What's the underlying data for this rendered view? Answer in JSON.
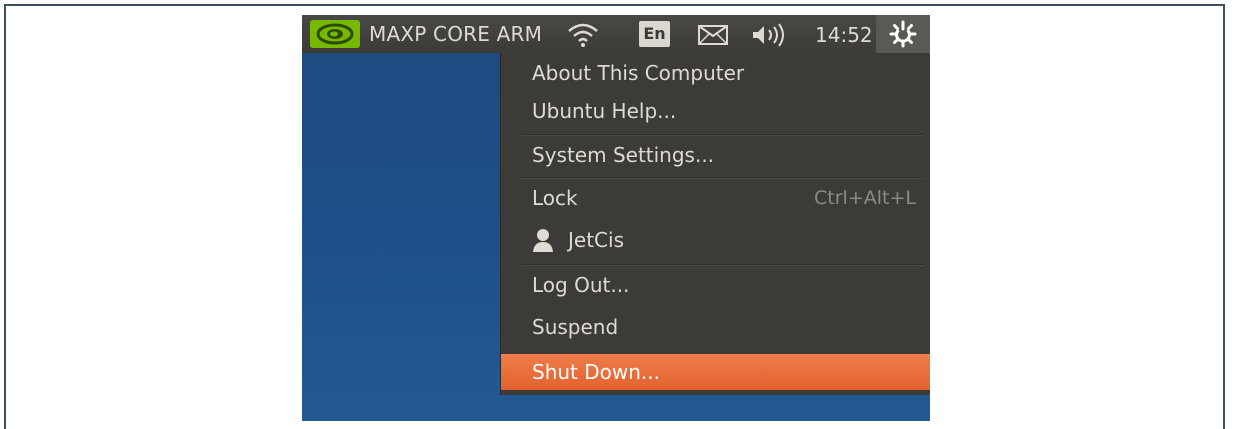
{
  "panel": {
    "app_title": "MAXP CORE ARM",
    "keyboard_lang": "En",
    "clock": "14:52"
  },
  "menu": {
    "items": [
      {
        "label": "About This Computer"
      },
      {
        "label": "Ubuntu Help..."
      },
      {
        "label": "System Settings..."
      },
      {
        "label": "Lock",
        "shortcut": "Ctrl+Alt+L"
      },
      {
        "label": "JetCis"
      },
      {
        "label": "Log Out..."
      },
      {
        "label": "Suspend"
      },
      {
        "label": "Shut Down..."
      }
    ],
    "highlight_color": "#e9693a"
  },
  "colors": {
    "panel_bg": "#3c3b37",
    "desktop_bg": "#1f4f8a",
    "frame_border": "#3d4f5f"
  },
  "icons": [
    "nvidia-logo-icon",
    "wifi-icon",
    "mail-icon",
    "volume-icon",
    "gear-power-icon",
    "user-icon"
  ]
}
